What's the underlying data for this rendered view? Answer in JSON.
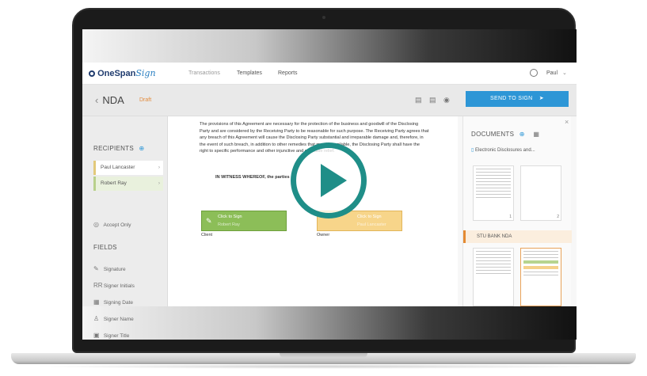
{
  "app": {
    "logo_main": "OneSpan",
    "logo_sign": "Sign",
    "nav": [
      "Transactions",
      "Templates",
      "Reports"
    ],
    "user": "Paul"
  },
  "header": {
    "title": "NDA",
    "back": "‹",
    "status": "Draft",
    "send_button": "SEND TO SIGN"
  },
  "sidebar": {
    "recipients_heading": "RECIPIENTS",
    "recipients": [
      "Paul Lancaster",
      "Robert Ray"
    ],
    "accept_only": "Accept Only",
    "fields_heading": "FIELDS",
    "fields": [
      {
        "label": "Signature",
        "icon": "pen-icon"
      },
      {
        "label": "Signer Initials",
        "icon": "initials-icon"
      },
      {
        "label": "Signing Date",
        "icon": "calendar-icon"
      },
      {
        "label": "Signer Name",
        "icon": "person-icon"
      },
      {
        "label": "Signer Title",
        "icon": "title-icon"
      }
    ]
  },
  "document": {
    "paragraph": "The provisions of this Agreement are necessary for the protection of the business and goodwill of the Disclosing Party and are considered by the Receiving Party to be reasonable for such purpose. The Receiving Party agrees that any breach of this Agreement will cause the Disclosing Party substantial and irreparable damage and, therefore, in the event of such breach, in addition to other remedies that may be available, the Disclosing Party shall have the right to specific performance and other injunctive and equitable relief.",
    "witness": "IN WITNESS WHEREOF, the parties",
    "sig_client_label": "Click to Sign",
    "sig_client_name": "Robert Ray",
    "sig_owner_label": "Click to Sign",
    "sig_owner_name": "Paul Lancaster",
    "client": "Client",
    "owner": "Owner"
  },
  "documents_panel": {
    "heading": "DOCUMENTS",
    "items": [
      "Electronic Disclosures and...",
      "STU BANK NDA"
    ],
    "page_numbers": [
      "1",
      "2"
    ]
  },
  "colors": {
    "send_button": "#2d96d6",
    "play_ring": "#1f8e88",
    "draft": "#e38b3c"
  }
}
